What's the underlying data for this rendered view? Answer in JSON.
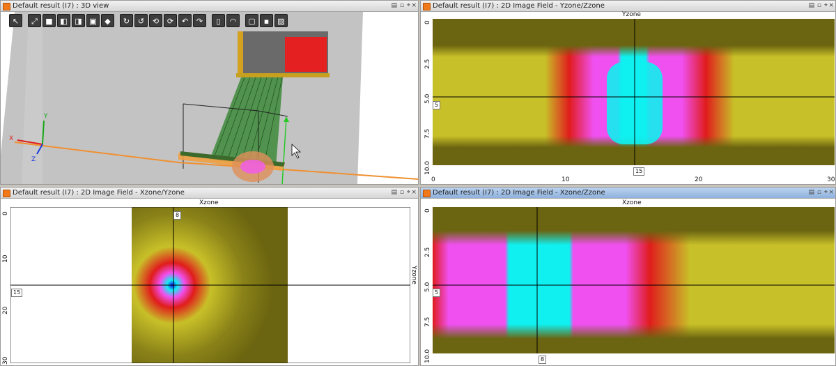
{
  "panels": {
    "view3d": {
      "title": "Default result (I7) : 3D view"
    },
    "yz": {
      "title": "Default result (I7) : 2D Image Field - Yzone/Zzone",
      "top_label": "Yzone",
      "left_ticks": [
        "0",
        "2.5",
        "5.0",
        "7.5",
        "10.0"
      ],
      "bottom_ticks": [
        "0",
        "10",
        "20",
        "30"
      ],
      "marker_left": "5",
      "marker_bottom": "15"
    },
    "xz": {
      "title": "Default result (I7) : 2D Image Field - Xzone/Yzone",
      "top_label": "Xzone",
      "right_label": "Yzone",
      "left_ticks": [
        "0",
        "10",
        "20",
        "30"
      ],
      "marker_top": "8",
      "marker_left": "15"
    },
    "xz2": {
      "title": "Default result (I7) : 2D Image Field - Xzone/Zzone",
      "top_label": "Xzone",
      "left_ticks": [
        "0",
        "2.5",
        "5.0",
        "7.5",
        "10.0"
      ],
      "marker_left": "5",
      "marker_bottom": "8"
    }
  },
  "axis_triad": {
    "x": "X",
    "y": "Y",
    "z": "Z"
  },
  "window_controls": [
    "pin",
    "float",
    "close"
  ],
  "toolbar_icons": [
    "select-arrow-icon",
    "fit-view-icon",
    "cube-front-icon",
    "cube-back-icon",
    "cube-left-icon",
    "cube-right-icon",
    "cube-iso-icon",
    "rotate-cw-icon",
    "rotate-ccw-icon",
    "rotate-up-icon",
    "rotate-down-icon",
    "rotate-left-icon",
    "rotate-right-icon",
    "section-icon",
    "dome-icon",
    "box-icon",
    "box-solid-icon",
    "hatch-icon"
  ],
  "colors": {
    "olive": "#6b6410",
    "yellow": "#c8c028",
    "red": "#e01c1c",
    "magenta": "#f050f0",
    "cyan": "#10f0f0",
    "blue": "#1010f0"
  }
}
